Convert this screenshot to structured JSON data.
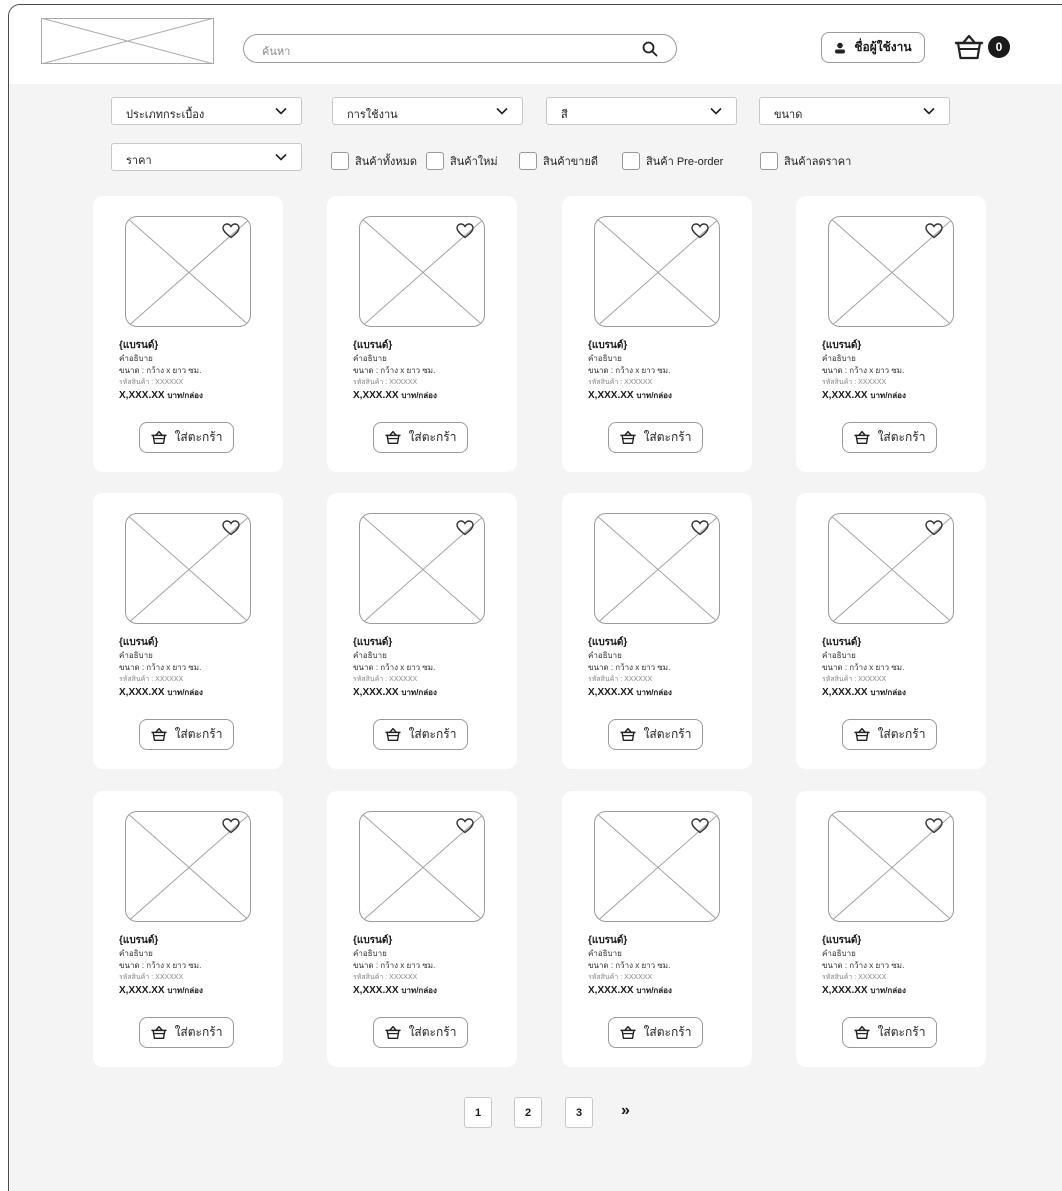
{
  "header": {
    "search_placeholder": "ค้นหา",
    "user_label": "ชื่อผู้ใช้งาน",
    "cart_count": "0"
  },
  "filters": {
    "dropdowns": [
      {
        "label": "ประเภทกระเบื้อง"
      },
      {
        "label": "การใช้งาน"
      },
      {
        "label": "สี"
      },
      {
        "label": "ขนาด"
      },
      {
        "label": "ราคา"
      }
    ],
    "checkboxes": [
      {
        "label": "สินค้าทั้งหมด",
        "checked": false
      },
      {
        "label": "สินค้าใหม่",
        "checked": false
      },
      {
        "label": "สินค้าขายดี",
        "checked": false
      },
      {
        "label": "สินค้า Pre-order",
        "checked": false
      },
      {
        "label": "สินค้าลดราคา",
        "checked": false
      }
    ]
  },
  "product": {
    "brand": "{แบรนด์}",
    "description": "คำอธิบาย",
    "size": "ขนาด :  กว้าง x ยาว  ซม.",
    "code": "รหัสสินค้า :  XXXXXX",
    "price": "X,XXX.XX",
    "unit": "บาท/กล่อง",
    "add_to_cart": "ใส่ตะกร้า"
  },
  "products_count": 12,
  "pagination": {
    "pages": [
      "1",
      "2",
      "3"
    ],
    "next": "»"
  },
  "icons": {
    "search": "search-icon",
    "user": "user-icon",
    "cart": "basket-icon",
    "favorite": "heart-icon",
    "dropdown": "chevron-down-icon"
  }
}
